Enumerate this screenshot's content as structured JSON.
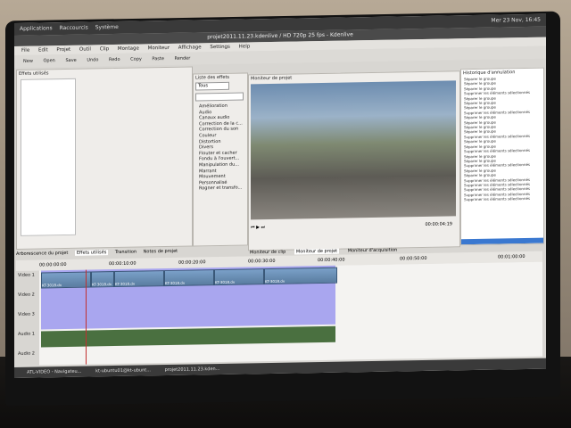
{
  "system_bar": {
    "items": [
      "Applications",
      "Raccourcis",
      "Système"
    ]
  },
  "window": {
    "title": "projet2011.11.23.kdenlive / HD 720p 25 fps - Kdenlive"
  },
  "menu": [
    "File",
    "Edit",
    "Projet",
    "Outil",
    "Clip",
    "Montage",
    "Moniteur",
    "Affichage",
    "Settings",
    "Help"
  ],
  "toolbar": [
    "New",
    "Open",
    "Save",
    "Undo",
    "Redo",
    "Copy",
    "Paste",
    "Render"
  ],
  "panels": {
    "used_effects": "Effets utilisés",
    "effects_list": "Liste des effets",
    "monitor": "Moniteur de projet",
    "history": "Historique d'annulation"
  },
  "effects": [
    "Tous",
    "Amélioration",
    "Audio",
    "Canaux audio",
    "Correction de la c...",
    "Correction du son",
    "Couleur",
    "Distortion",
    "Divers",
    "Flouter et cacher",
    "Fondu à l'ouvert...",
    "Manipulation du...",
    "Marrant",
    "Mouvement",
    "Personnalisé",
    "Rogner et transfo..."
  ],
  "history": [
    "Séparer le groupe",
    "Séparer le groupe",
    "Séparer le groupe",
    "Supprimer les éléments sélectionnés",
    "Séparer le groupe",
    "Séparer le groupe",
    "Séparer le groupe",
    "Supprimer les éléments sélectionnés",
    "Séparer le groupe",
    "Séparer le groupe",
    "Séparer le groupe",
    "Séparer le groupe",
    "Supprimer les éléments sélectionnés",
    "Séparer le groupe",
    "Séparer le groupe",
    "Supprimer les éléments sélectionnés",
    "Séparer le groupe",
    "Séparer le groupe",
    "Supprimer les éléments sélectionnés",
    "Séparer le groupe",
    "Séparer le groupe",
    "Supprimer les éléments sélectionnés",
    "Supprimer les éléments sélectionnés",
    "Supprimer les éléments sélectionnés",
    "Supprimer les éléments sélectionnés",
    "Supprimer les éléments sélectionnés"
  ],
  "tabs_left": [
    "Arborescence du projet",
    "Effets utilisés",
    "Transition",
    "Notes de projet"
  ],
  "tabs_monitor": [
    "Moniteur de clip",
    "Moniteur de projet",
    "Moniteur d'acquisition"
  ],
  "timecode": "00:00:04:19",
  "ruler": [
    "00:00:00:00",
    "00:00:10:00",
    "00:00:20:00",
    "00:00:30:00",
    "00:00:40:00",
    "00:00:50:00",
    "00:01:00:00"
  ],
  "tracks": [
    "Video 1",
    "Video 2",
    "Video 3",
    "Audio 1",
    "Audio 2"
  ],
  "clip_label": "KT-3018.dv",
  "taskbar": [
    "ATL-VIDEO - Navigateu...",
    "kt-ubuntu01@kt-ubunt...",
    "projet2011.11.23.kden..."
  ],
  "clock": "Mer 23 Nov, 16:45"
}
